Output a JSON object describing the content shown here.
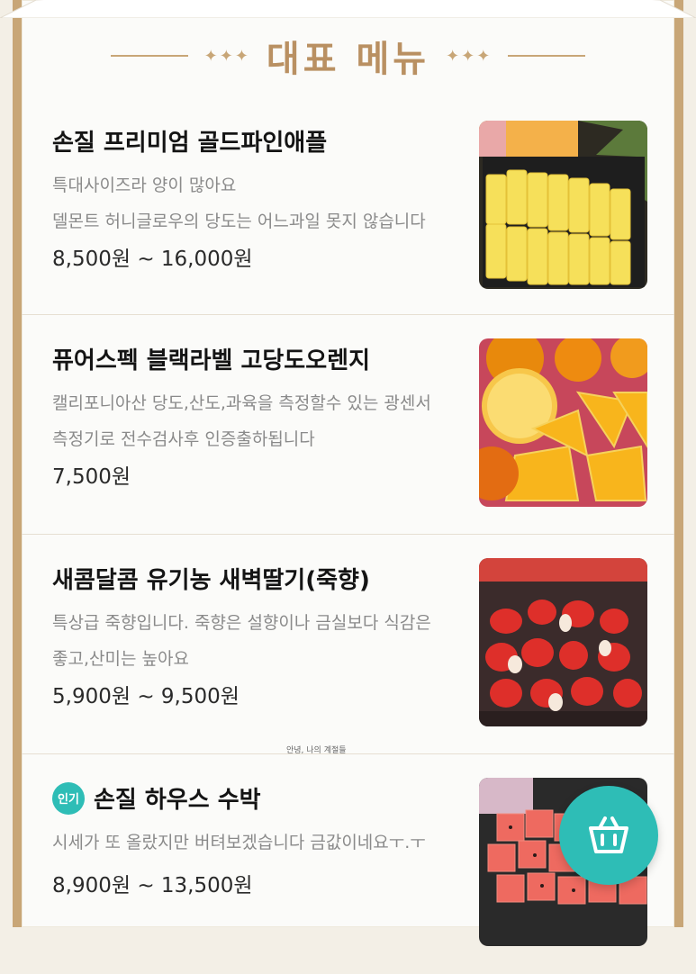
{
  "header": {
    "title": "대표 메뉴",
    "ornament": "✦✦✦"
  },
  "menu": [
    {
      "name": "손질 프리미엄 골드파인애플",
      "badge": "",
      "desc1": "특대사이즈라 양이 많아요",
      "desc2": "델몬트 허니글로우의 당도는 어느과일 못지 않습니다",
      "price": "8,500원 ~ 16,000원"
    },
    {
      "name": "퓨어스펙 블랙라벨 고당도오렌지",
      "badge": "",
      "desc1": "캘리포니아산 당도,산도,과육을 측정할수 있는 광센서",
      "desc2": "측정기로 전수검사후 인증출하됩니다",
      "price": "7,500원"
    },
    {
      "name": "새콤달콤 유기농 새벽딸기(죽향)",
      "badge": "",
      "desc1": "특상급 죽향입니다. 죽향은 설향이나 금실보다 식감은",
      "desc2": "좋고,산미는 높아요",
      "price": "5,900원 ~ 9,500원"
    },
    {
      "name": "손질 하우스 수박",
      "badge": "인기",
      "desc1": "시세가 또 올랐지만 버텨보겠습니다 금값이네요ㅜ.ㅜ",
      "desc2": "",
      "price": "8,900원 ~ 13,500원"
    }
  ],
  "watermark": "안녕, 나의 계절들",
  "colors": {
    "accent": "#2ebdb6",
    "gold": "#c8a677",
    "title": "#b99062"
  },
  "icons": {
    "cart": "basket-icon"
  }
}
